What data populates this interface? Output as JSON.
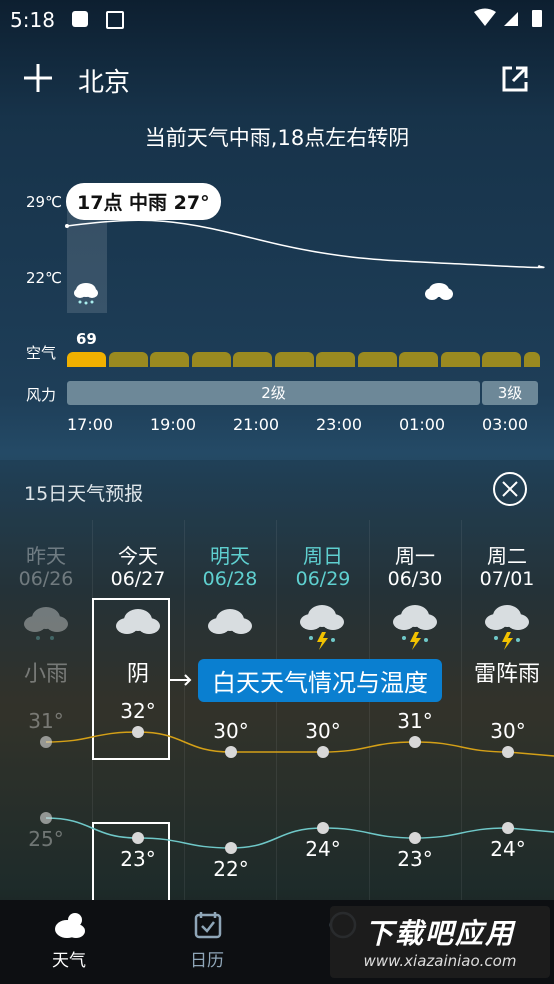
{
  "status": {
    "time": "5:18"
  },
  "appbar": {
    "city": "北京"
  },
  "summary": "当前天气中雨,18点左右转阴",
  "hourly": {
    "tooltip": "17点 中雨 27°",
    "temp_high": "29℃",
    "temp_low": "22℃",
    "air_label": "空气",
    "aqi": "69",
    "wind_label": "风力",
    "wind_levels": [
      "2级",
      "3级"
    ],
    "times": [
      "17:00",
      "19:00",
      "21:00",
      "23:00",
      "01:00",
      "03:00"
    ]
  },
  "forecast": {
    "title": "15日天气预报",
    "callout": "白天天气情况与温度",
    "days": [
      {
        "name": "昨天",
        "date": "06/26",
        "cond": "小雨",
        "high": "31°",
        "low": "25°"
      },
      {
        "name": "今天",
        "date": "06/27",
        "cond": "阴",
        "high": "32°",
        "low": "23°"
      },
      {
        "name": "明天",
        "date": "06/28",
        "cond": "",
        "high": "30°",
        "low": "22°"
      },
      {
        "name": "周日",
        "date": "06/29",
        "cond": "",
        "high": "30°",
        "low": "24°"
      },
      {
        "name": "周一",
        "date": "06/30",
        "cond": "",
        "high": "31°",
        "low": "23°"
      },
      {
        "name": "周二",
        "date": "07/01",
        "cond": "雷阵雨",
        "high": "30°",
        "low": "24°"
      }
    ],
    "colors": {
      "high_line": "#d4a017",
      "low_line": "#6fc8c8",
      "accent_teal": "#5fd0d0"
    }
  },
  "tabs": [
    {
      "label": "天气"
    },
    {
      "label": "日历"
    },
    {
      "label": ""
    }
  ],
  "watermark": "下载吧应用 www.xiazainiao.com"
}
